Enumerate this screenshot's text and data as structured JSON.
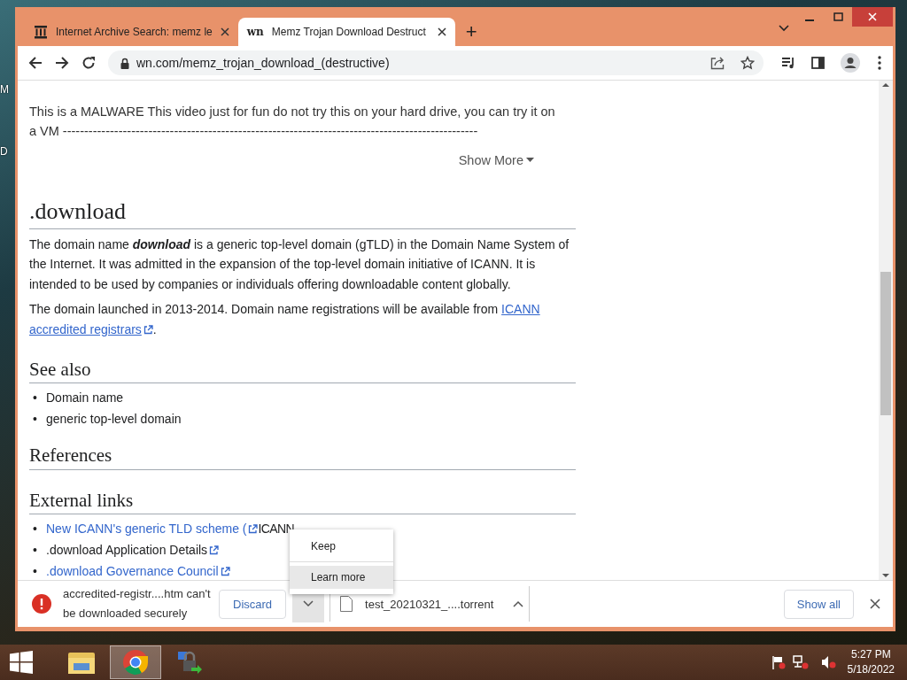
{
  "desktop_labels": [
    "M",
    "D"
  ],
  "tabs": [
    {
      "title": "Internet Archive Search: memz le",
      "kind": "archive",
      "selected": false
    },
    {
      "title": "Memz Trojan Download Destruct",
      "kind": "text",
      "favicon_text": "wn",
      "selected": true
    }
  ],
  "new_tab": "+",
  "address": "wn.com/memz_trojan_download_(destructive)",
  "page": {
    "description": "This is a MALWARE This video just for fun do not try this on your hard drive, you can try it on a VM -------------------------------------------------------------------------------------------------",
    "show_more": "Show More",
    "heading": ".download",
    "paragraphs": [
      [
        {
          "kind": "text",
          "text": "The domain name **download** is a generic top-level domain (gTLD) in the Domain Name System of the Internet. It was admitted in the expansion of the top-level domain initiative of ICANN. It is intended to be used by companies or individuals offering downloadable content globally."
        }
      ],
      [
        {
          "kind": "text",
          "text": "The domain launched in 2013-2014. Domain name registrations will be available from "
        },
        {
          "kind": "link",
          "text": "ICANN",
          "external": false
        },
        {
          "kind": "link",
          "text": "accredited registrars",
          "external": true
        },
        {
          "kind": "text",
          "text": "."
        }
      ]
    ],
    "see_also": {
      "title": "See also",
      "items": [
        {
          "marker": "•",
          "parts": [
            {
              "kind": "text",
              "text": "Domain name"
            }
          ]
        },
        {
          "marker": "•",
          "parts": [
            {
              "kind": "text",
              "text": "generic top-level domain"
            }
          ]
        }
      ]
    },
    "references": {
      "title": "References"
    },
    "external_links": {
      "title": "External links",
      "items": [
        {
          "marker": "•",
          "parts": [
            {
              "kind": "link",
              "text": "New ICANN's generic TLD scheme (",
              "external": true
            },
            {
              "kind": "text",
              "text": "ICANN"
            }
          ]
        },
        {
          "marker": "•",
          "parts": [
            {
              "kind": "text",
              "text": ".download Application Details",
              "external": true
            }
          ]
        },
        {
          "marker": "•",
          "parts": [
            {
              "kind": "link",
              "text": ".download Governance Council",
              "external": true
            }
          ]
        }
      ]
    }
  },
  "menu": [
    {
      "label": "Keep",
      "selected": false
    },
    {
      "label": "Learn more",
      "selected": true
    }
  ],
  "downloads": [
    {
      "kind": "blocked",
      "name": "accredited-registr....htm can't be downloaded securely",
      "action": "Discard"
    },
    {
      "kind": "file",
      "name": "test_20210321_....torrent"
    }
  ],
  "show_all": "Show all",
  "taskbar": [
    {
      "kind": "explorer",
      "selected": false
    },
    {
      "kind": "chrome",
      "selected": true
    },
    {
      "kind": "network",
      "selected": false
    }
  ],
  "clock": {
    "time": "5:27 PM",
    "date": "5/18/2022"
  }
}
